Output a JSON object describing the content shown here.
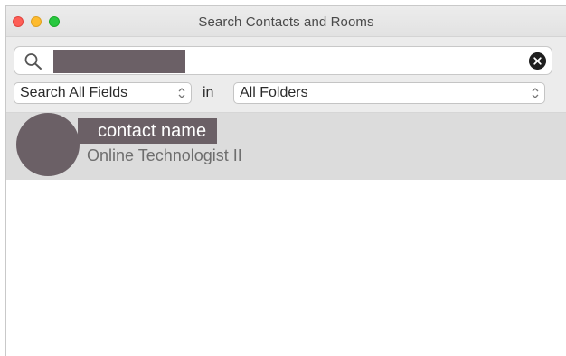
{
  "window": {
    "title": "Search Contacts and Rooms"
  },
  "search": {
    "value": "",
    "clear_icon": "clear-circle-icon",
    "icon": "magnifier-icon"
  },
  "filters": {
    "fields_selected": "Search All Fields",
    "in_label": "in",
    "folders_selected": "All Folders"
  },
  "results": [
    {
      "name": "contact name",
      "title": "Online Technologist II"
    }
  ],
  "colors": {
    "redaction": "#6b6066",
    "row_highlight": "#dcdcdc",
    "close": "#fe5f57",
    "minimize": "#febb2e",
    "maximize": "#28c840"
  }
}
